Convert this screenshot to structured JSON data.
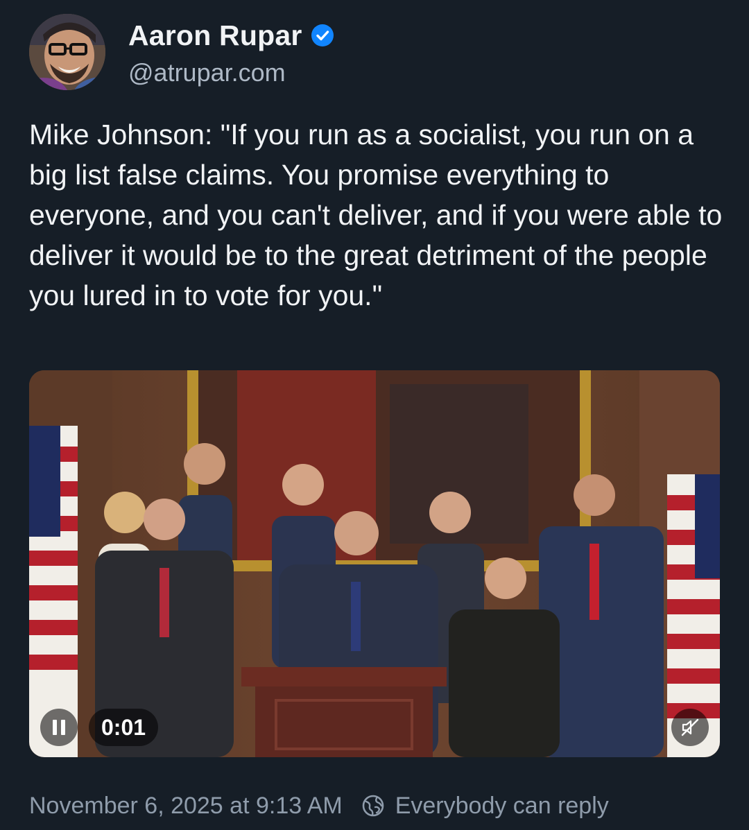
{
  "author": {
    "display_name": "Aaron Rupar",
    "handle": "@atrupar.com",
    "verified": true,
    "avatar_icon": "avatar-photo"
  },
  "post": {
    "text": "Mike Johnson: \"If you run as a socialist, you run on a big list false claims. You promise everything to everyone, and you can't deliver, and if you were able to deliver it would be to the great detriment of the people you lured in to vote for you.\""
  },
  "video": {
    "state": "playing",
    "elapsed": "0:01",
    "muted": true,
    "pause_icon": "pause-icon",
    "mute_icon": "speaker-muted-icon"
  },
  "meta": {
    "timestamp": "November 6, 2025 at 9:13 AM",
    "reply_setting": "Everybody can reply",
    "reply_icon": "globe-icon"
  },
  "colors": {
    "background": "#161e27",
    "text": "#f1f3f5",
    "muted_text": "#8f9cab",
    "verified": "#1185fe"
  }
}
